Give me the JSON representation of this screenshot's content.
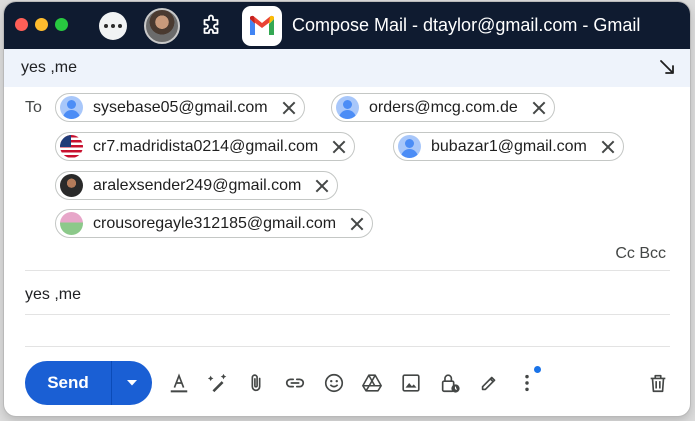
{
  "window": {
    "title": "Compose Mail - dtaylor@gmail.com - Gmail"
  },
  "compose": {
    "subject": "yes ,me",
    "to_label": "To",
    "recipients": [
      {
        "email": "sysebase05@gmail.com",
        "avatar": "default-avatar"
      },
      {
        "email": "orders@mcg.com.de",
        "avatar": "default-avatar"
      },
      {
        "email": "cr7.madridista0214@gmail.com",
        "avatar": "us-flag-avatar"
      },
      {
        "email": "bubazar1@gmail.com",
        "avatar": "default-avatar"
      },
      {
        "email": "aralexsender249@gmail.com",
        "avatar": "photo-avatar"
      },
      {
        "email": "crousoregayle312185@gmail.com",
        "avatar": "scenic-avatar"
      }
    ],
    "cc_bcc": "Cc Bcc",
    "body": "yes ,me",
    "send_label": "Send"
  },
  "toolbar": {
    "icons": [
      "text-format-icon",
      "ai-write-icon",
      "attach-icon",
      "link-icon",
      "emoji-icon",
      "drive-icon",
      "photo-icon",
      "confidential-mode-icon",
      "signature-icon",
      "more-options-icon",
      "trash-icon"
    ]
  },
  "colors": {
    "titlebar": "#0f1b30",
    "subject_bar": "#eef3fb",
    "send_button": "#1a5fd4"
  }
}
